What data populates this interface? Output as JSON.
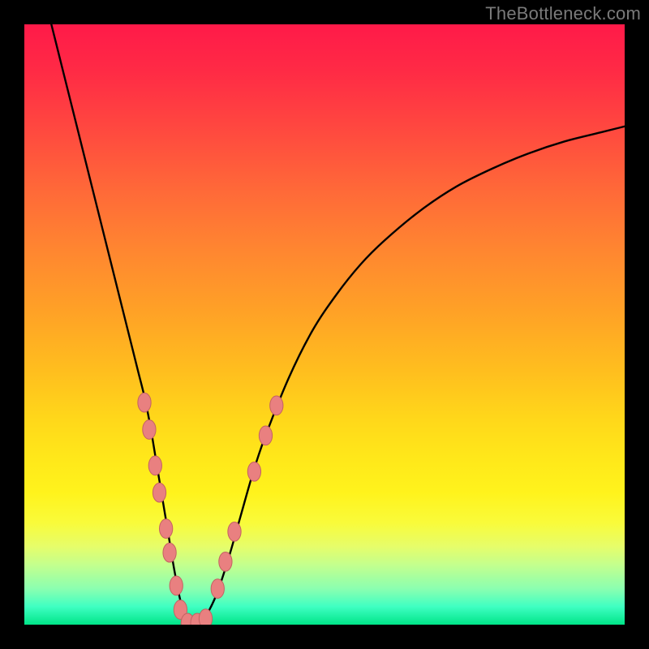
{
  "watermark": "TheBottleneck.com",
  "colors": {
    "bead_fill": "#e98080",
    "bead_stroke": "#c46262",
    "curve_stroke": "#000000"
  },
  "chart_data": {
    "type": "line",
    "title": "",
    "xlabel": "",
    "ylabel": "",
    "xlim": [
      0,
      100
    ],
    "ylim": [
      0,
      100
    ],
    "series": [
      {
        "name": "bottleneck-curve",
        "x": [
          4,
          6,
          8,
          10,
          12,
          14,
          16,
          18,
          19,
          20,
          21,
          22,
          23,
          24,
          25,
          26,
          27,
          28,
          29,
          30,
          32,
          34,
          36,
          38,
          40,
          44,
          48,
          52,
          56,
          60,
          66,
          72,
          78,
          84,
          90,
          96,
          100
        ],
        "y": [
          102,
          94,
          86,
          78,
          70,
          62,
          54,
          46,
          42,
          38,
          33,
          27,
          21,
          15,
          9,
          4,
          1,
          0,
          0,
          1,
          5,
          11,
          18,
          25,
          31,
          41,
          49,
          55,
          60,
          64,
          69,
          73,
          76,
          78.5,
          80.5,
          82,
          83
        ]
      }
    ],
    "markers": {
      "name": "highlight-beads",
      "rx": 1.1,
      "ry": 1.6,
      "points": [
        {
          "x": 20.0,
          "y": 37.0
        },
        {
          "x": 20.8,
          "y": 32.5
        },
        {
          "x": 21.8,
          "y": 26.5
        },
        {
          "x": 22.5,
          "y": 22.0
        },
        {
          "x": 23.6,
          "y": 16.0
        },
        {
          "x": 24.2,
          "y": 12.0
        },
        {
          "x": 25.3,
          "y": 6.5
        },
        {
          "x": 26.0,
          "y": 2.5
        },
        {
          "x": 27.2,
          "y": 0.3
        },
        {
          "x": 28.8,
          "y": 0.3
        },
        {
          "x": 30.2,
          "y": 1.0
        },
        {
          "x": 32.2,
          "y": 6.0
        },
        {
          "x": 33.5,
          "y": 10.5
        },
        {
          "x": 35.0,
          "y": 15.5
        },
        {
          "x": 38.3,
          "y": 25.5
        },
        {
          "x": 40.2,
          "y": 31.5
        },
        {
          "x": 42.0,
          "y": 36.5
        }
      ]
    }
  }
}
